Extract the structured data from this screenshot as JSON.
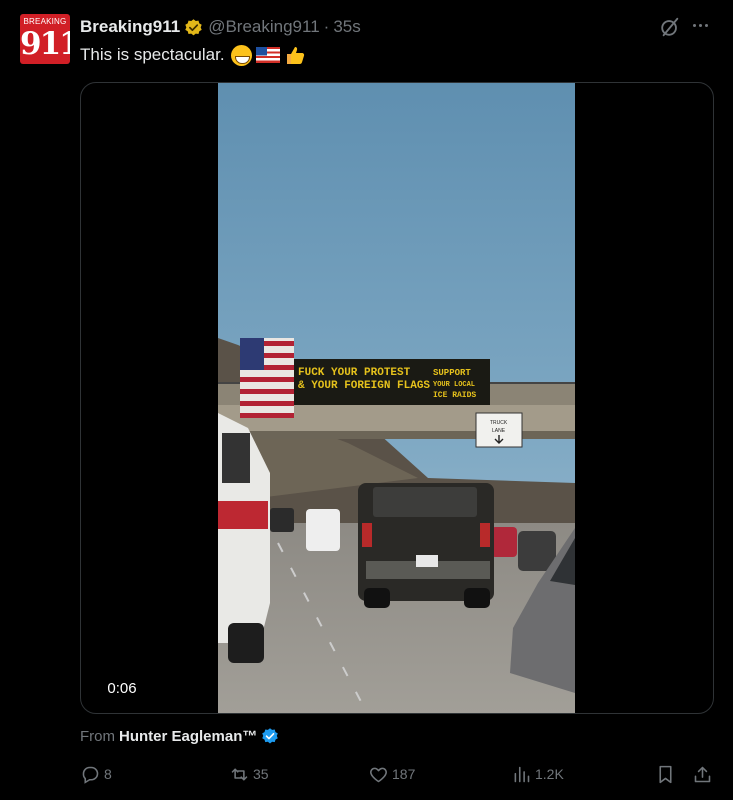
{
  "post": {
    "avatar": {
      "top_text": "BREAKING",
      "number_text": "911"
    },
    "author_name": "Breaking911",
    "handle": "@Breaking911",
    "separator": "·",
    "time": "35s",
    "text": "This is spectacular.",
    "emojis": [
      "grinning-face",
      "us-flag",
      "thumbs-up"
    ]
  },
  "video": {
    "timestamp": "0:06",
    "sign_lines": [
      "FUCK YOUR PROTEST",
      "& YOUR FOREIGN FLAGS",
      "SUPPORT",
      "YOUR LOCAL",
      "ICE RAIDS"
    ],
    "truck_sign_lines": [
      "TRUCK",
      "LANE"
    ]
  },
  "source": {
    "label": "From",
    "name": "Hunter Eagleman™"
  },
  "actions": {
    "replies": "8",
    "reposts": "35",
    "likes": "187",
    "views": "1.2K"
  },
  "colors": {
    "background": "#000000",
    "text_primary": "#e7e9ea",
    "text_secondary": "#71767b",
    "verified_blue": "#1d9bf0",
    "verified_gold": "#e2b719",
    "avatar_red": "#d11f26"
  }
}
